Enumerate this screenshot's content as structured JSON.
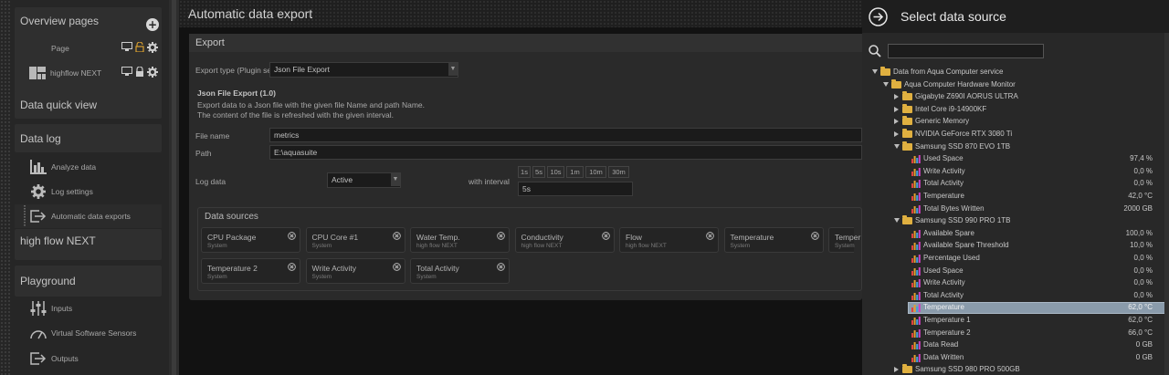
{
  "sidebar": {
    "overview_pages": "Overview pages",
    "pages": [
      {
        "label": "Page"
      },
      {
        "label": "highflow NEXT"
      }
    ],
    "data_quick_view": "Data quick view",
    "data_log": "Data log",
    "data_log_items": [
      "Analyze data",
      "Log settings",
      "Automatic data exports"
    ],
    "high_flow_next": "high flow NEXT",
    "playground": "Playground",
    "playground_items": [
      "Inputs",
      "Virtual Software Sensors",
      "Outputs"
    ]
  },
  "main": {
    "title": "Automatic data export",
    "export_panel_title": "Export",
    "export_type_label": "Export type (Plugin sel",
    "export_type_value": "Json File Export",
    "plugin_title": "Json File Export (1.0)",
    "plugin_desc_1": "Export data to a Json file with the given file Name and path Name.",
    "plugin_desc_2": "The content of the file is refreshed with the given interval.",
    "file_name_label": "File name",
    "file_name_value": "metrics",
    "path_label": "Path",
    "path_value": "E:\\aquasuite",
    "log_data_label": "Log data",
    "log_data_value": "Active",
    "interval_label": "with interval",
    "interval_presets": [
      "1s",
      "5s",
      "10s",
      "1m",
      "10m",
      "30m"
    ],
    "interval_value": "5s",
    "data_sources_title": "Data sources",
    "data_sources": [
      {
        "name": "CPU Package",
        "source": "System"
      },
      {
        "name": "CPU Core #1",
        "source": "System"
      },
      {
        "name": "Water Temp.",
        "source": "high flow NEXT"
      },
      {
        "name": "Conductivity",
        "source": "high flow NEXT"
      },
      {
        "name": "Flow",
        "source": "high flow NEXT"
      },
      {
        "name": "Temperature",
        "source": "System"
      },
      {
        "name": "Temper",
        "source": "System"
      },
      {
        "name": "Temperature 2",
        "source": "System"
      },
      {
        "name": "Write Activity",
        "source": "System"
      },
      {
        "name": "Total Activity",
        "source": "System"
      }
    ]
  },
  "right_panel": {
    "title": "Select data source",
    "search_placeholder": "",
    "tree": [
      {
        "level": 0,
        "type": "folder",
        "open": true,
        "label": "Data from Aqua Computer service",
        "value": ""
      },
      {
        "level": 1,
        "type": "folder",
        "open": true,
        "label": "Aqua Computer Hardware Monitor",
        "value": ""
      },
      {
        "level": 2,
        "type": "folder",
        "open": false,
        "label": "Gigabyte Z690I AORUS ULTRA",
        "value": ""
      },
      {
        "level": 2,
        "type": "folder",
        "open": false,
        "label": "Intel Core i9-14900KF",
        "value": ""
      },
      {
        "level": 2,
        "type": "folder",
        "open": false,
        "label": "Generic Memory",
        "value": ""
      },
      {
        "level": 2,
        "type": "folder",
        "open": false,
        "label": "NVIDIA GeForce RTX 3080 Ti",
        "value": ""
      },
      {
        "level": 2,
        "type": "folder",
        "open": true,
        "label": "Samsung SSD 870 EVO 1TB",
        "value": ""
      },
      {
        "level": 3,
        "type": "sensor",
        "label": "Used Space",
        "value": "97,4 %"
      },
      {
        "level": 3,
        "type": "sensor",
        "label": "Write Activity",
        "value": "0,0 %"
      },
      {
        "level": 3,
        "type": "sensor",
        "label": "Total Activity",
        "value": "0,0 %"
      },
      {
        "level": 3,
        "type": "sensor",
        "label": "Temperature",
        "value": "42,0 °C"
      },
      {
        "level": 3,
        "type": "sensor",
        "label": "Total Bytes Written",
        "value": "2000 GB"
      },
      {
        "level": 2,
        "type": "folder",
        "open": true,
        "label": "Samsung SSD 990 PRO 1TB",
        "value": ""
      },
      {
        "level": 3,
        "type": "sensor",
        "label": "Available Spare",
        "value": "100,0 %"
      },
      {
        "level": 3,
        "type": "sensor",
        "label": "Available Spare Threshold",
        "value": "10,0 %"
      },
      {
        "level": 3,
        "type": "sensor",
        "label": "Percentage Used",
        "value": "0,0 %"
      },
      {
        "level": 3,
        "type": "sensor",
        "label": "Used Space",
        "value": "0,0 %"
      },
      {
        "level": 3,
        "type": "sensor",
        "label": "Write Activity",
        "value": "0,0 %"
      },
      {
        "level": 3,
        "type": "sensor",
        "label": "Total Activity",
        "value": "0,0 %"
      },
      {
        "level": 3,
        "type": "sensor",
        "label": "Temperature",
        "value": "62,0 °C",
        "selected": true
      },
      {
        "level": 3,
        "type": "sensor",
        "label": "Temperature 1",
        "value": "62,0 °C"
      },
      {
        "level": 3,
        "type": "sensor",
        "label": "Temperature 2",
        "value": "66,0 °C"
      },
      {
        "level": 3,
        "type": "sensor",
        "label": "Data Read",
        "value": "0 GB"
      },
      {
        "level": 3,
        "type": "sensor",
        "label": "Data Written",
        "value": "0 GB"
      },
      {
        "level": 2,
        "type": "folder",
        "open": false,
        "label": "Samsung SSD 980 PRO 500GB",
        "value": ""
      }
    ]
  },
  "colors": {
    "folder": "#e0b040",
    "selection": "#8a9bab",
    "sensor_bar_1": "#e04040",
    "sensor_bar_2": "#e0a030",
    "sensor_bar_3": "#40a0e0",
    "sensor_bar_4": "#d040c0"
  }
}
